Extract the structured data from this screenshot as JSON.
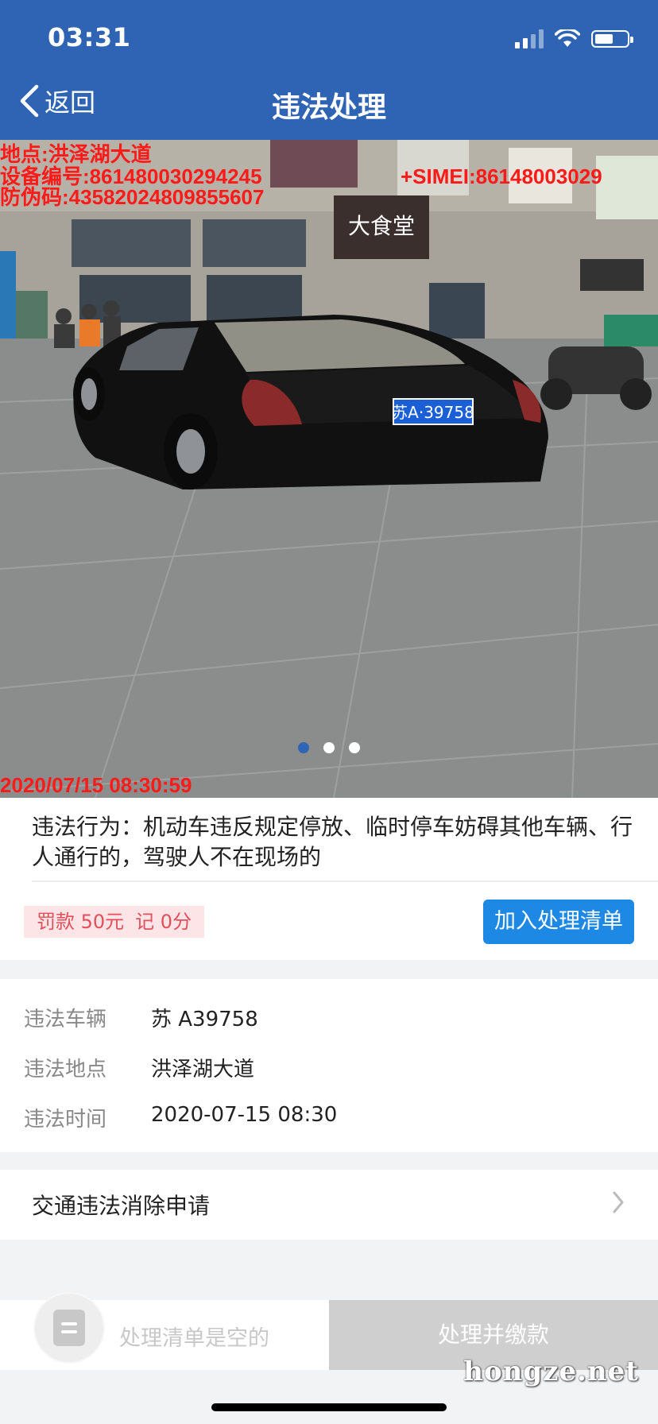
{
  "status_bar": {
    "time": "03:31"
  },
  "nav": {
    "back_label": "返回",
    "title": "违法处理"
  },
  "photo": {
    "overlay_location": "地点:洪泽湖大道",
    "overlay_device": "设备编号:861480030294245",
    "overlay_simei": "+SIMEI:86148003029",
    "overlay_code": "防伪码:43582024809855607",
    "overlay_timestamp": "2020/07/15 08:30:59",
    "plate_text": "苏A·39758",
    "sign_text": "大食堂",
    "dots_total": 3,
    "dots_active": 1
  },
  "violation": {
    "description": "违法行为：机动车违反规定停放、临时停车妨碍其他车辆、行人通行的，驾驶人不在现场的",
    "fine": "罚款 50元",
    "points": "记 0分",
    "add_button": "加入处理清单"
  },
  "details": [
    {
      "label": "违法车辆",
      "value": "苏 A39758"
    },
    {
      "label": "违法地点",
      "value": "洪泽湖大道"
    },
    {
      "label": "违法时间",
      "value": "2020-07-15 08:30"
    }
  ],
  "appeal_link": "交通违法消除申请",
  "bottom": {
    "empty_text": "处理清单是空的",
    "pay_button": "处理并缴款",
    "watermark": "hongze.net"
  }
}
